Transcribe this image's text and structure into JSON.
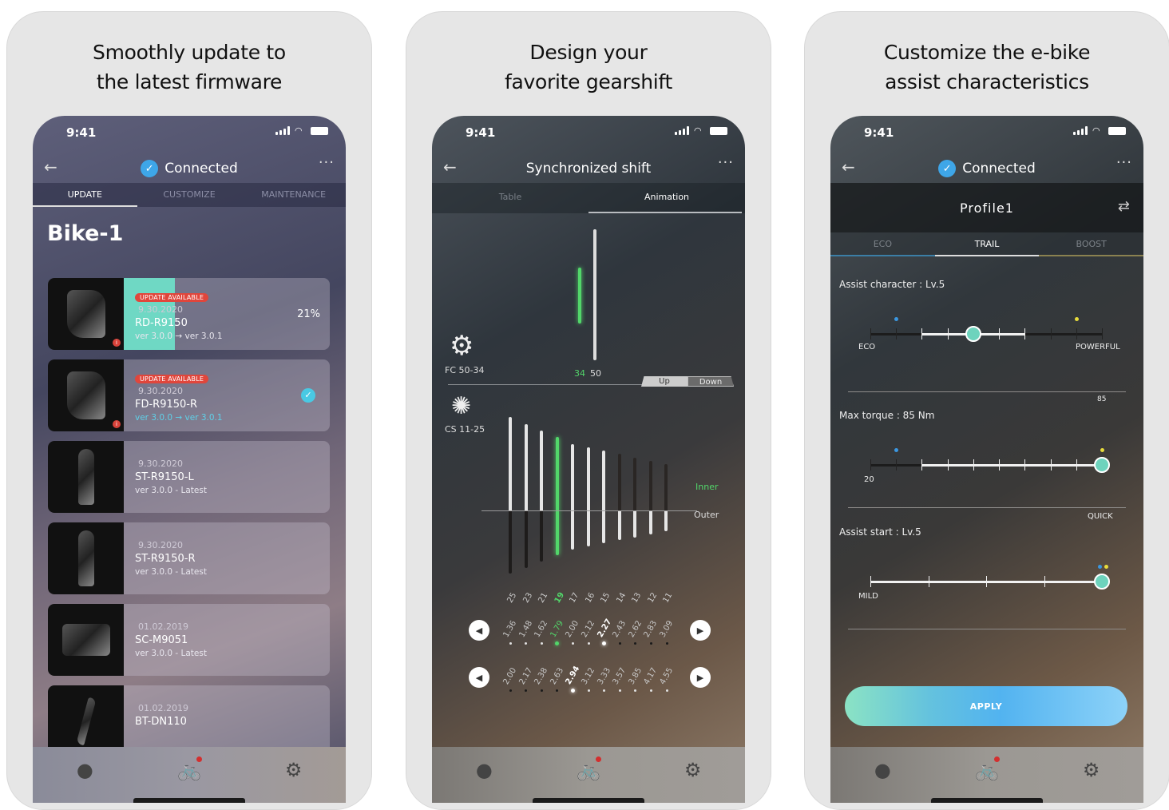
{
  "panels": [
    {
      "headline_line1": "Smoothly update to",
      "headline_line2": "the latest firmware",
      "phone": {
        "time": "9:41",
        "nav_title": "Connected",
        "tabs": [
          "UPDATE",
          "CUSTOMIZE",
          "MAINTENANCE"
        ],
        "active_tab": "UPDATE",
        "bike_name": "Bike-1",
        "components": [
          {
            "badge": "UPDATE AVAILABLE",
            "date": "9.30.2020",
            "name": "RD-R9150",
            "version": "ver 3.0.0 → ver 3.0.1",
            "progress_percent": 21,
            "progress_label": "21%"
          },
          {
            "badge": "UPDATE AVAILABLE",
            "date": "9.30.2020",
            "name": "FD-R9150-R",
            "version": "ver 3.0.0 → ver 3.0.1",
            "status": "complete"
          },
          {
            "date": "9.30.2020",
            "name": "ST-R9150-L",
            "version": "ver 3.0.0 - Latest"
          },
          {
            "date": "9.30.2020",
            "name": "ST-R9150-R",
            "version": "ver 3.0.0 - Latest"
          },
          {
            "date": "01.02.2019",
            "name": "SC-M9051",
            "version": "ver 3.0.0 - Latest"
          },
          {
            "date": "01.02.2019",
            "name": "BT-DN110",
            "version": ""
          }
        ]
      }
    },
    {
      "headline_line1": "Design your",
      "headline_line2": "favorite gearshift",
      "phone": {
        "time": "9:41",
        "nav_title": "Synchronized shift",
        "tabs": [
          "Table",
          "Animation"
        ],
        "active_tab": "Animation",
        "crank_label": "FC 50-34",
        "chainrings": [
          "34",
          "50"
        ],
        "active_chainring": "34",
        "toggle": [
          "Up",
          "Down"
        ],
        "cassette_label": "CS 11-25",
        "sprockets": [
          "25",
          "23",
          "21",
          "19",
          "17",
          "16",
          "15",
          "14",
          "13",
          "12",
          "11"
        ],
        "active_sprocket": "19",
        "legend_inner": "Inner",
        "legend_outer": "Outer",
        "ratios_inner": [
          "1.36",
          "1.48",
          "1.62",
          "1.79",
          "2.00",
          "2.12",
          "2.27",
          "2.43",
          "2.62",
          "2.83",
          "3.09"
        ],
        "ratios_outer": [
          "2.00",
          "2.17",
          "2.38",
          "2.63",
          "2.94",
          "3.12",
          "3.33",
          "3.57",
          "3.85",
          "4.17",
          "4.55"
        ],
        "active_inner_ratio": "1.79",
        "highlight_inner_ratio": "2.27",
        "highlight_outer_ratio": "2.94"
      }
    },
    {
      "headline_line1": "Customize the e-bike",
      "headline_line2": "assist characteristics",
      "phone": {
        "time": "9:41",
        "nav_title": "Connected",
        "profile": "Profile1",
        "mode_tabs": [
          "ECO",
          "TRAIL",
          "BOOST"
        ],
        "active_mode": "TRAIL",
        "assist_character": {
          "label": "Assist character : Lv.5",
          "left": "ECO",
          "right": "POWERFUL",
          "level": 5,
          "max": 10
        },
        "max_torque": {
          "label": "Max torque : 85 Nm",
          "value_label": "85",
          "min_label": "20",
          "right_label": "QUICK",
          "value": 85
        },
        "assist_start": {
          "label": "Assist start : Lv.5",
          "left": "MILD",
          "level": 5,
          "max": 5
        },
        "apply_label": "APPLY"
      }
    }
  ],
  "tabbar": {
    "items": [
      "tips-bulb-icon",
      "bike-icon",
      "settings-gear-icon"
    ],
    "active": "bike-icon"
  },
  "colors": {
    "accent_teal": "#6ed3bd",
    "badge_red": "#e0463c",
    "check_blue": "#3ea6e8",
    "green": "#4cd964"
  }
}
